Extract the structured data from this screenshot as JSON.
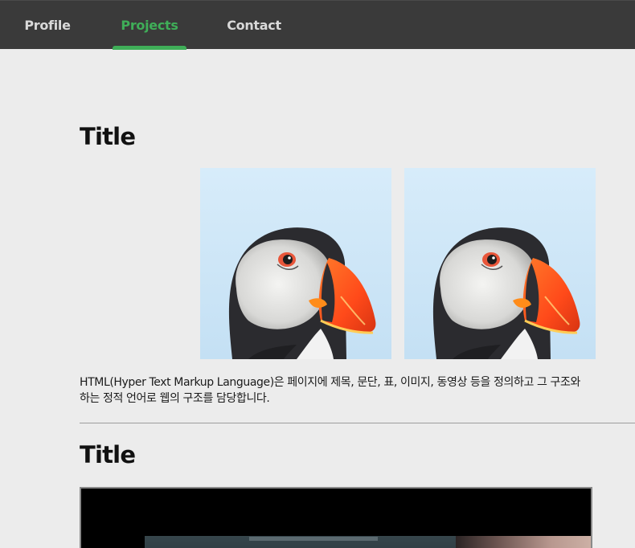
{
  "nav": {
    "tabs": [
      {
        "label": "Profile",
        "active": false
      },
      {
        "label": "Projects",
        "active": true
      },
      {
        "label": "Contact",
        "active": false
      }
    ],
    "active_color": "#3fae58"
  },
  "sections": [
    {
      "title": "Title",
      "images": [
        {
          "subject": "puffin",
          "icon": "puffin-photo"
        },
        {
          "subject": "puffin",
          "icon": "puffin-photo"
        }
      ],
      "description_line1": "HTML(Hyper Text Markup Language)은 페이지에 제목, 문단, 표, 이미지, 동영상 등을 정의하고 그 구조와",
      "description_line2": "하는 정적 언어로 웹의 구조를 담당합니다."
    },
    {
      "title": "Title",
      "media": "video"
    }
  ]
}
